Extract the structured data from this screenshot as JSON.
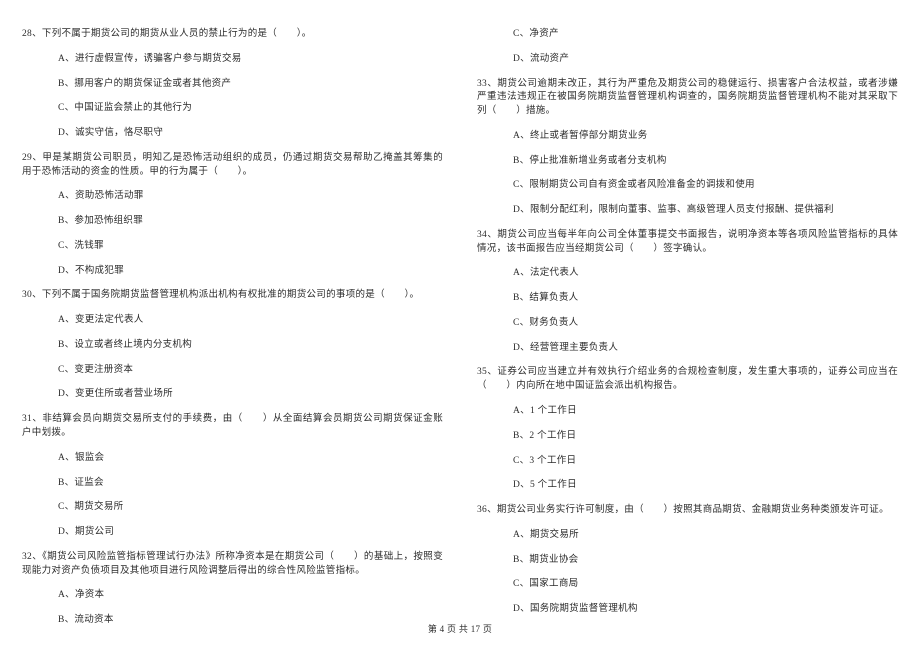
{
  "left": {
    "q28": {
      "stem": "28、下列不属于期货公司的期货从业人员的禁止行为的是（　　）。",
      "A": "A、进行虚假宣传，诱骗客户参与期货交易",
      "B": "B、挪用客户的期货保证金或者其他资产",
      "C": "C、中国证监会禁止的其他行为",
      "D": "D、诚实守信，恪尽职守"
    },
    "q29": {
      "stem": "29、甲是某期货公司职员，明知乙是恐怖活动组织的成员，仍通过期货交易帮助乙掩盖其筹集的用于恐怖活动的资金的性质。甲的行为属于（　　）。",
      "A": "A、资助恐怖活动罪",
      "B": "B、参加恐怖组织罪",
      "C": "C、洗钱罪",
      "D": "D、不构成犯罪"
    },
    "q30": {
      "stem": "30、下列不属于国务院期货监督管理机构派出机构有权批准的期货公司的事项的是（　　）。",
      "A": "A、变更法定代表人",
      "B": "B、设立或者终止境内分支机构",
      "C": "C、变更注册资本",
      "D": "D、变更住所或者营业场所"
    },
    "q31": {
      "stem": "31、非结算会员向期货交易所支付的手续费，由（　　）从全面结算会员期货公司期货保证金账户中划拨。",
      "A": "A、银监会",
      "B": "B、证监会",
      "C": "C、期货交易所",
      "D": "D、期货公司"
    },
    "q32": {
      "stem": "32、《期货公司风险监管指标管理试行办法》所称净资本是在期货公司（　　）的基础上，按照变现能力对资产负债项目及其他项目进行风险调整后得出的综合性风险监管指标。",
      "A": "A、净资本",
      "B": "B、流动资本"
    }
  },
  "right": {
    "q32r": {
      "C": "C、净资产",
      "D": "D、流动资产"
    },
    "q33": {
      "stem": "33、期货公司逾期未改正，其行为严重危及期货公司的稳健运行、损害客户合法权益，或者涉嫌严重违法违规正在被国务院期货监督管理机构调查的，国务院期货监督管理机构不能对其采取下列（　　）措施。",
      "A": "A、终止或者暂停部分期货业务",
      "B": "B、停止批准新增业务或者分支机构",
      "C": "C、限制期货公司自有资金或者风险准备金的调拨和使用",
      "D": "D、限制分配红利，限制向董事、监事、高级管理人员支付报酬、提供福利"
    },
    "q34": {
      "stem": "34、期货公司应当每半年向公司全体董事提交书面报告，说明净资本等各项风险监管指标的具体情况，该书面报告应当经期货公司（　　）签字确认。",
      "A": "A、法定代表人",
      "B": "B、结算负责人",
      "C": "C、财务负责人",
      "D": "D、经营管理主要负责人"
    },
    "q35": {
      "stem": "35、证券公司应当建立并有效执行介绍业务的合规检查制度，发生重大事项的，证券公司应当在（　　）内向所在地中国证监会派出机构报告。",
      "A": "A、1 个工作日",
      "B": "B、2 个工作日",
      "C": "C、3 个工作日",
      "D": "D、5 个工作日"
    },
    "q36": {
      "stem": "36、期货公司业务实行许可制度，由（　　）按照其商品期货、金融期货业务种类颁发许可证。",
      "A": "A、期货交易所",
      "B": "B、期货业协会",
      "C": "C、国家工商局",
      "D": "D、国务院期货监督管理机构"
    }
  },
  "footer": "第 4 页 共 17 页"
}
